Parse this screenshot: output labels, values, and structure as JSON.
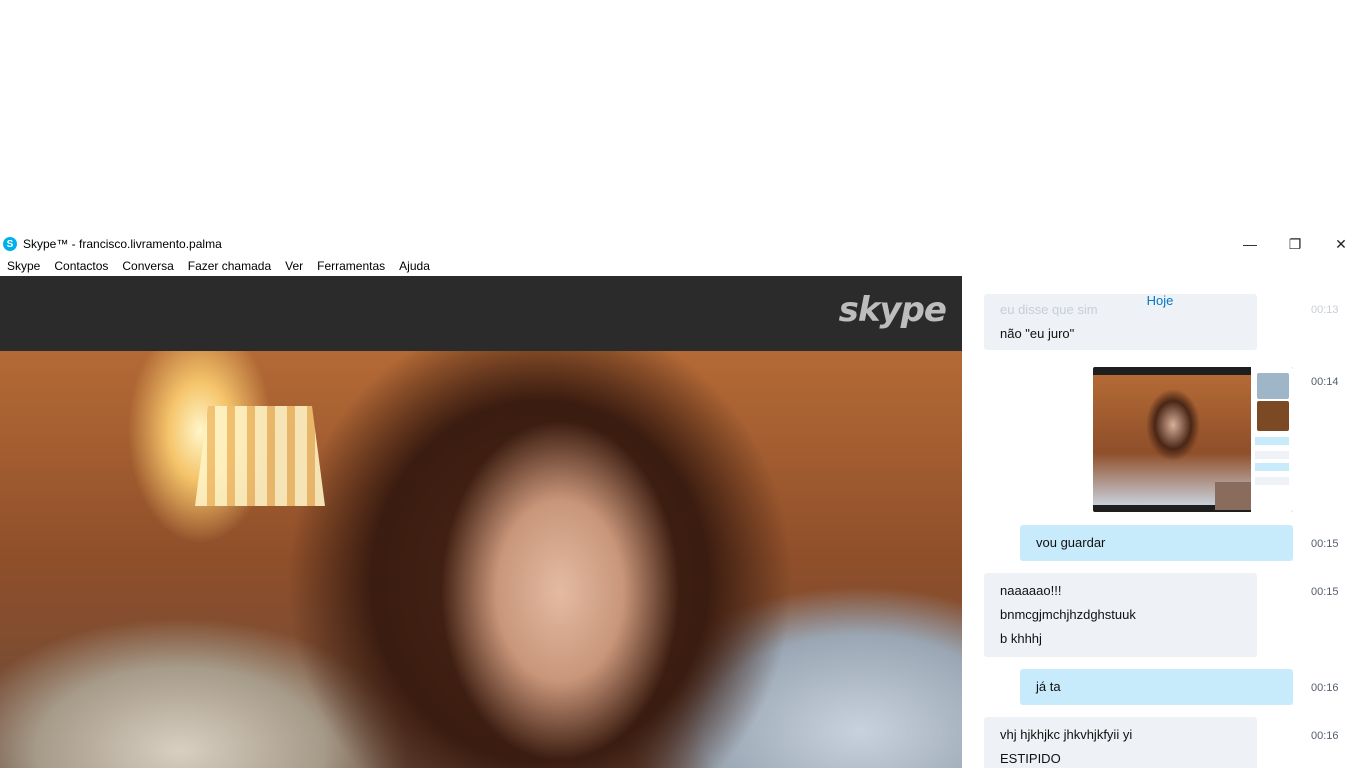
{
  "window": {
    "title": "Skype™ - francisco.livramento.palma",
    "controls": {
      "minimize": "—",
      "maximize": "❐",
      "close": "✕"
    }
  },
  "menu": [
    "Skype",
    "Contactos",
    "Conversa",
    "Fazer chamada",
    "Ver",
    "Ferramentas",
    "Ajuda"
  ],
  "video": {
    "logo_text": "skype"
  },
  "chat": {
    "date_label": "Hoje",
    "messages": [
      {
        "direction": "in",
        "lines": [
          "eu disse que sim",
          "não \"eu juro\""
        ],
        "time": "00:13"
      },
      {
        "direction": "out",
        "type": "image",
        "time": "00:14"
      },
      {
        "direction": "out",
        "lines": [
          "vou guardar"
        ],
        "time": "00:15"
      },
      {
        "direction": "in",
        "lines": [
          "naaaaao!!!",
          "bnmcgjmchjhzdghstuuk",
          "b khhhj"
        ],
        "time": "00:15"
      },
      {
        "direction": "out",
        "lines": [
          "já ta"
        ],
        "time": "00:16"
      },
      {
        "direction": "in",
        "lines": [
          " vhj hjkhjkc jhkvhjkfyii yi",
          "ESTIPIDO"
        ],
        "time": "00:16"
      }
    ]
  },
  "colors": {
    "accent": "#0078ca",
    "incoming_bubble": "#eef1f6",
    "outgoing_bubble": "#c7ebfb",
    "brand": "#00aff0"
  }
}
